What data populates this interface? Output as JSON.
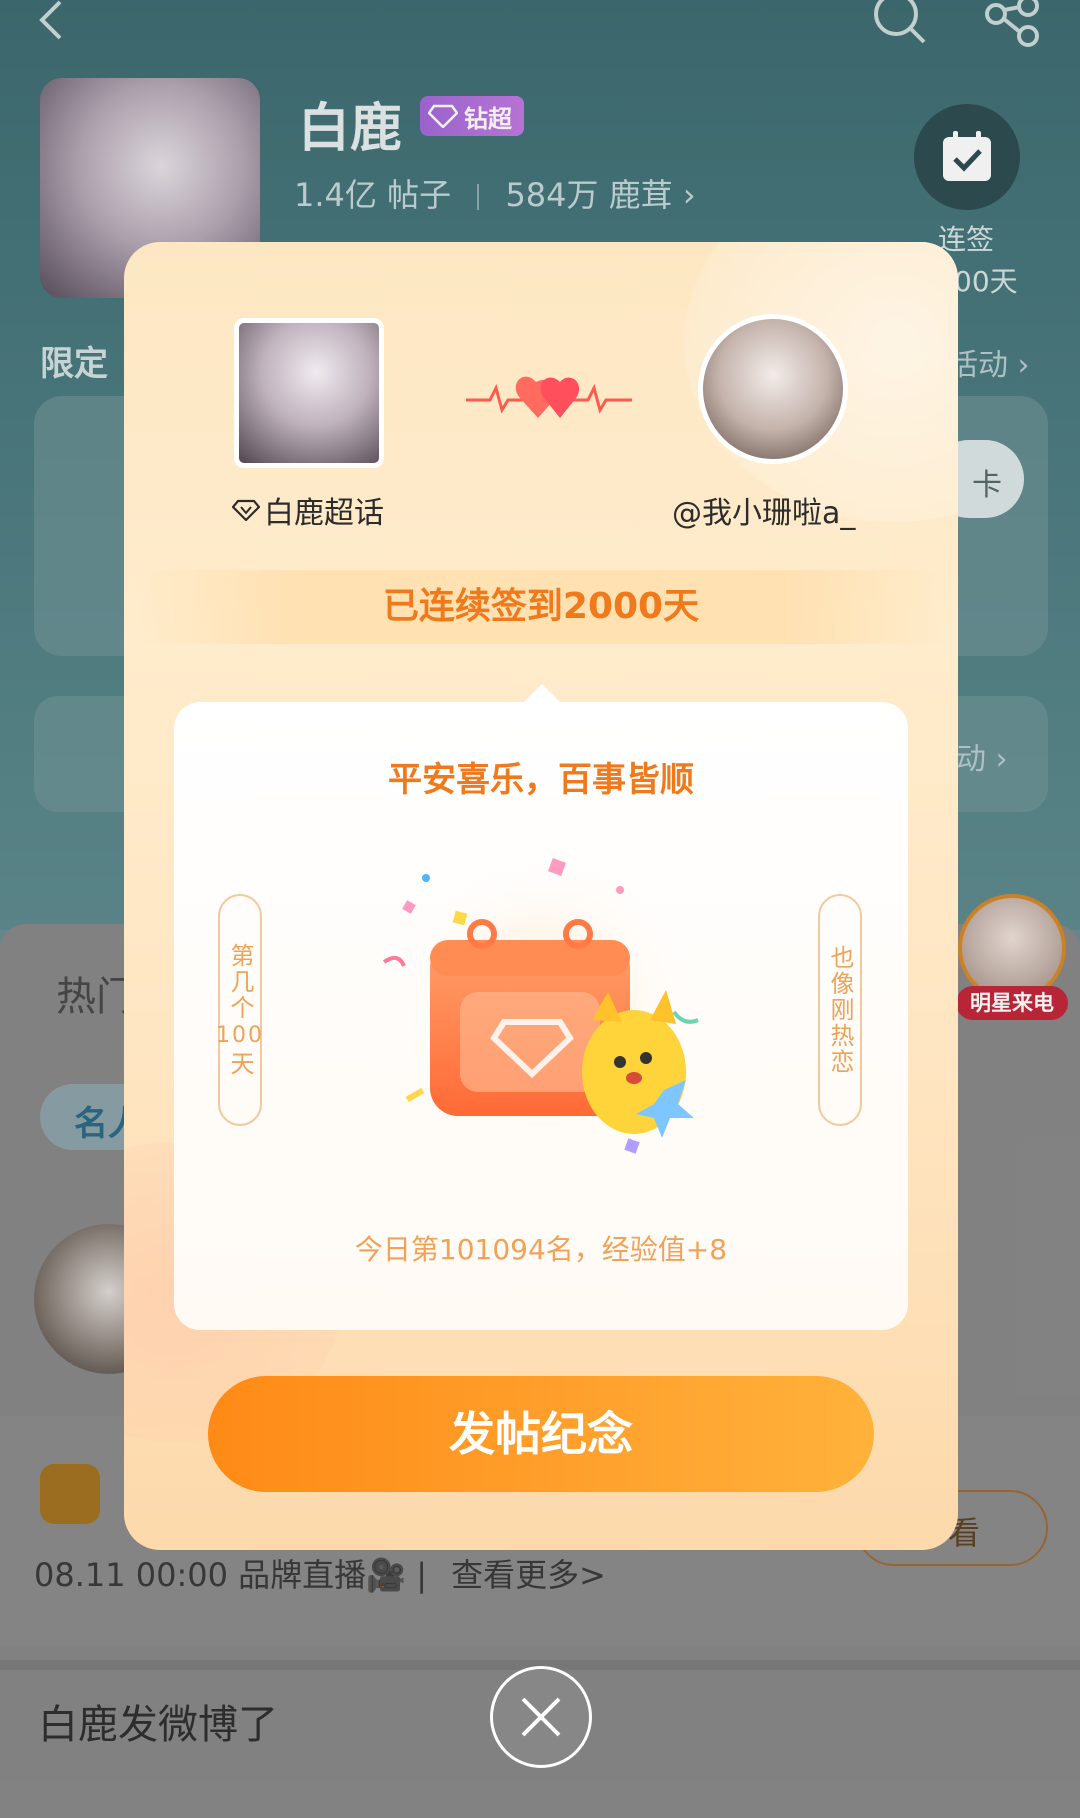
{
  "header": {
    "topic_name": "白鹿",
    "badge_label": "钻超",
    "posts_count": "1.4亿",
    "posts_label": "帖子",
    "fans_count": "584万",
    "fans_label": "鹿茸",
    "checkin_label": "连签",
    "checkin_days": "00天"
  },
  "background": {
    "limited_label": "限定",
    "activity_link": "活动 ›",
    "card_button_tail": "卡",
    "card_b_link": "动 ›",
    "tab_hot": "热门",
    "chip_label": "名人",
    "view_button": "看",
    "brand_line_prefix": "08.11 00:00 品牌直播🎥",
    "brand_line_more": "查看更多>",
    "weibo_title": "白鹿发微博了",
    "star_call_label": "明星来电"
  },
  "modal": {
    "topic_label": "白鹿超话",
    "user_name": "@我小珊啦a_",
    "days_banner": "已连续签到2000天",
    "blessing": "平安喜乐，百事皆顺",
    "scroll_left_top": "第几个",
    "scroll_left_num": "100",
    "scroll_left_bottom": "天",
    "scroll_right": "也像刚热恋",
    "rank_text": "今日第101094名，经验值+8",
    "post_button": "发帖纪念"
  },
  "colors": {
    "accent_orange": "#f07a1b",
    "button_gradient_start": "#ff8a16",
    "button_gradient_end": "#ffb23a",
    "modal_bg": "#ffeccc"
  }
}
